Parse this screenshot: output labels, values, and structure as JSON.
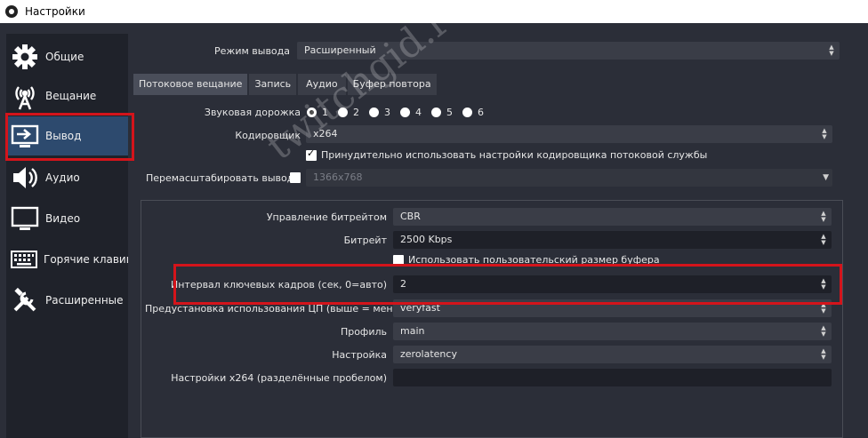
{
  "window": {
    "title": "Настройки"
  },
  "sidebar": {
    "items": [
      {
        "label": "Общие",
        "icon": "gear-icon"
      },
      {
        "label": "Вещание",
        "icon": "broadcast-antenna-icon"
      },
      {
        "label": "Вывод",
        "icon": "output-monitor-icon"
      },
      {
        "label": "Аудио",
        "icon": "speaker-icon"
      },
      {
        "label": "Видео",
        "icon": "monitor-icon"
      },
      {
        "label": "Горячие клавиш",
        "icon": "keyboard-icon"
      },
      {
        "label": "Расширенные",
        "icon": "tools-icon"
      }
    ],
    "active": "Вывод"
  },
  "output": {
    "mode_label": "Режим вывода",
    "mode_value": "Расширенный",
    "tabs": [
      "Потоковое вещание",
      "Запись",
      "Аудио",
      "Буфер повтора"
    ],
    "active_tab": "Потоковое вещание",
    "audio_track_label": "Звуковая дорожка",
    "audio_tracks": [
      "1",
      "2",
      "3",
      "4",
      "5",
      "6"
    ],
    "audio_track_selected": "1",
    "encoder_label": "Кодировщик",
    "encoder_value": "x264",
    "enforce_label": "Принудительно использовать настройки кодировщика потоковой службы",
    "enforce_checked": true,
    "rescale_label": "Перемасштабировать вывод",
    "rescale_checked": false,
    "rescale_value": "1366x768"
  },
  "encoder": {
    "rate_control_label": "Управление битрейтом",
    "rate_control_value": "CBR",
    "bitrate_label": "Битрейт",
    "bitrate_value": "2500 Kbps",
    "custom_buffer_label": "Использовать пользовательский размер буфера",
    "custom_buffer_checked": false,
    "keyframe_label": "Интервал ключевых кадров (сек, 0=авто)",
    "keyframe_value": "2",
    "preset_label": "Предустановка использования ЦП (выше = меньше)",
    "preset_value": "veryfast",
    "profile_label": "Профиль",
    "profile_value": "main",
    "tune_label": "Настройка",
    "tune_value": "zerolatency",
    "x264_opts_label": "Настройки x264 (разделённые пробелом)",
    "x264_opts_value": ""
  },
  "watermark": "twitchgid.ru",
  "colors": {
    "highlight": "#d4141b",
    "active_sidebar": "#2d4a6e"
  }
}
